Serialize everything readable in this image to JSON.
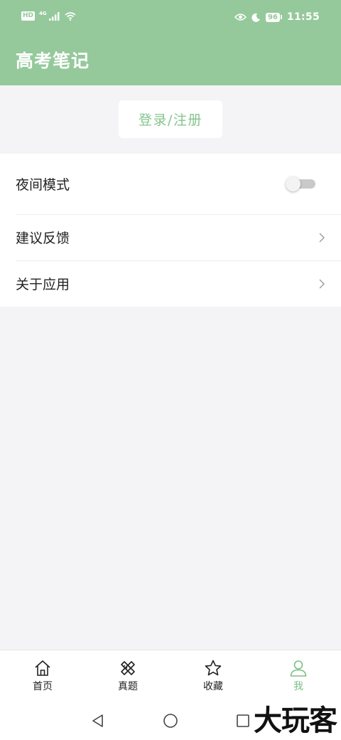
{
  "status_bar": {
    "hd_label": "HD",
    "network_label": "4G",
    "battery_level": "96",
    "time": "11:55",
    "icons": [
      "signal-icon",
      "wifi-icon",
      "eye-icon",
      "moon-icon",
      "battery-icon"
    ]
  },
  "header": {
    "title": "高考笔记"
  },
  "login_button": {
    "label": "登录/注册"
  },
  "settings": {
    "night_mode": {
      "label": "夜间模式",
      "enabled": false
    },
    "feedback": {
      "label": "建议反馈"
    },
    "about": {
      "label": "关于应用"
    }
  },
  "bottom_nav": {
    "items": [
      {
        "label": "首页",
        "icon": "home-icon",
        "active": false
      },
      {
        "label": "真题",
        "icon": "pencil-ruler-icon",
        "active": false
      },
      {
        "label": "收藏",
        "icon": "star-icon",
        "active": false
      },
      {
        "label": "我",
        "icon": "user-icon",
        "active": true
      }
    ]
  },
  "system_nav": {
    "icons": [
      "back-icon",
      "home-circle-icon",
      "recents-icon"
    ]
  },
  "watermark": {
    "text": "大玩客"
  },
  "colors": {
    "accent": "#95c99b",
    "accent_text": "#86c48e",
    "active_nav": "#7cbf86"
  }
}
